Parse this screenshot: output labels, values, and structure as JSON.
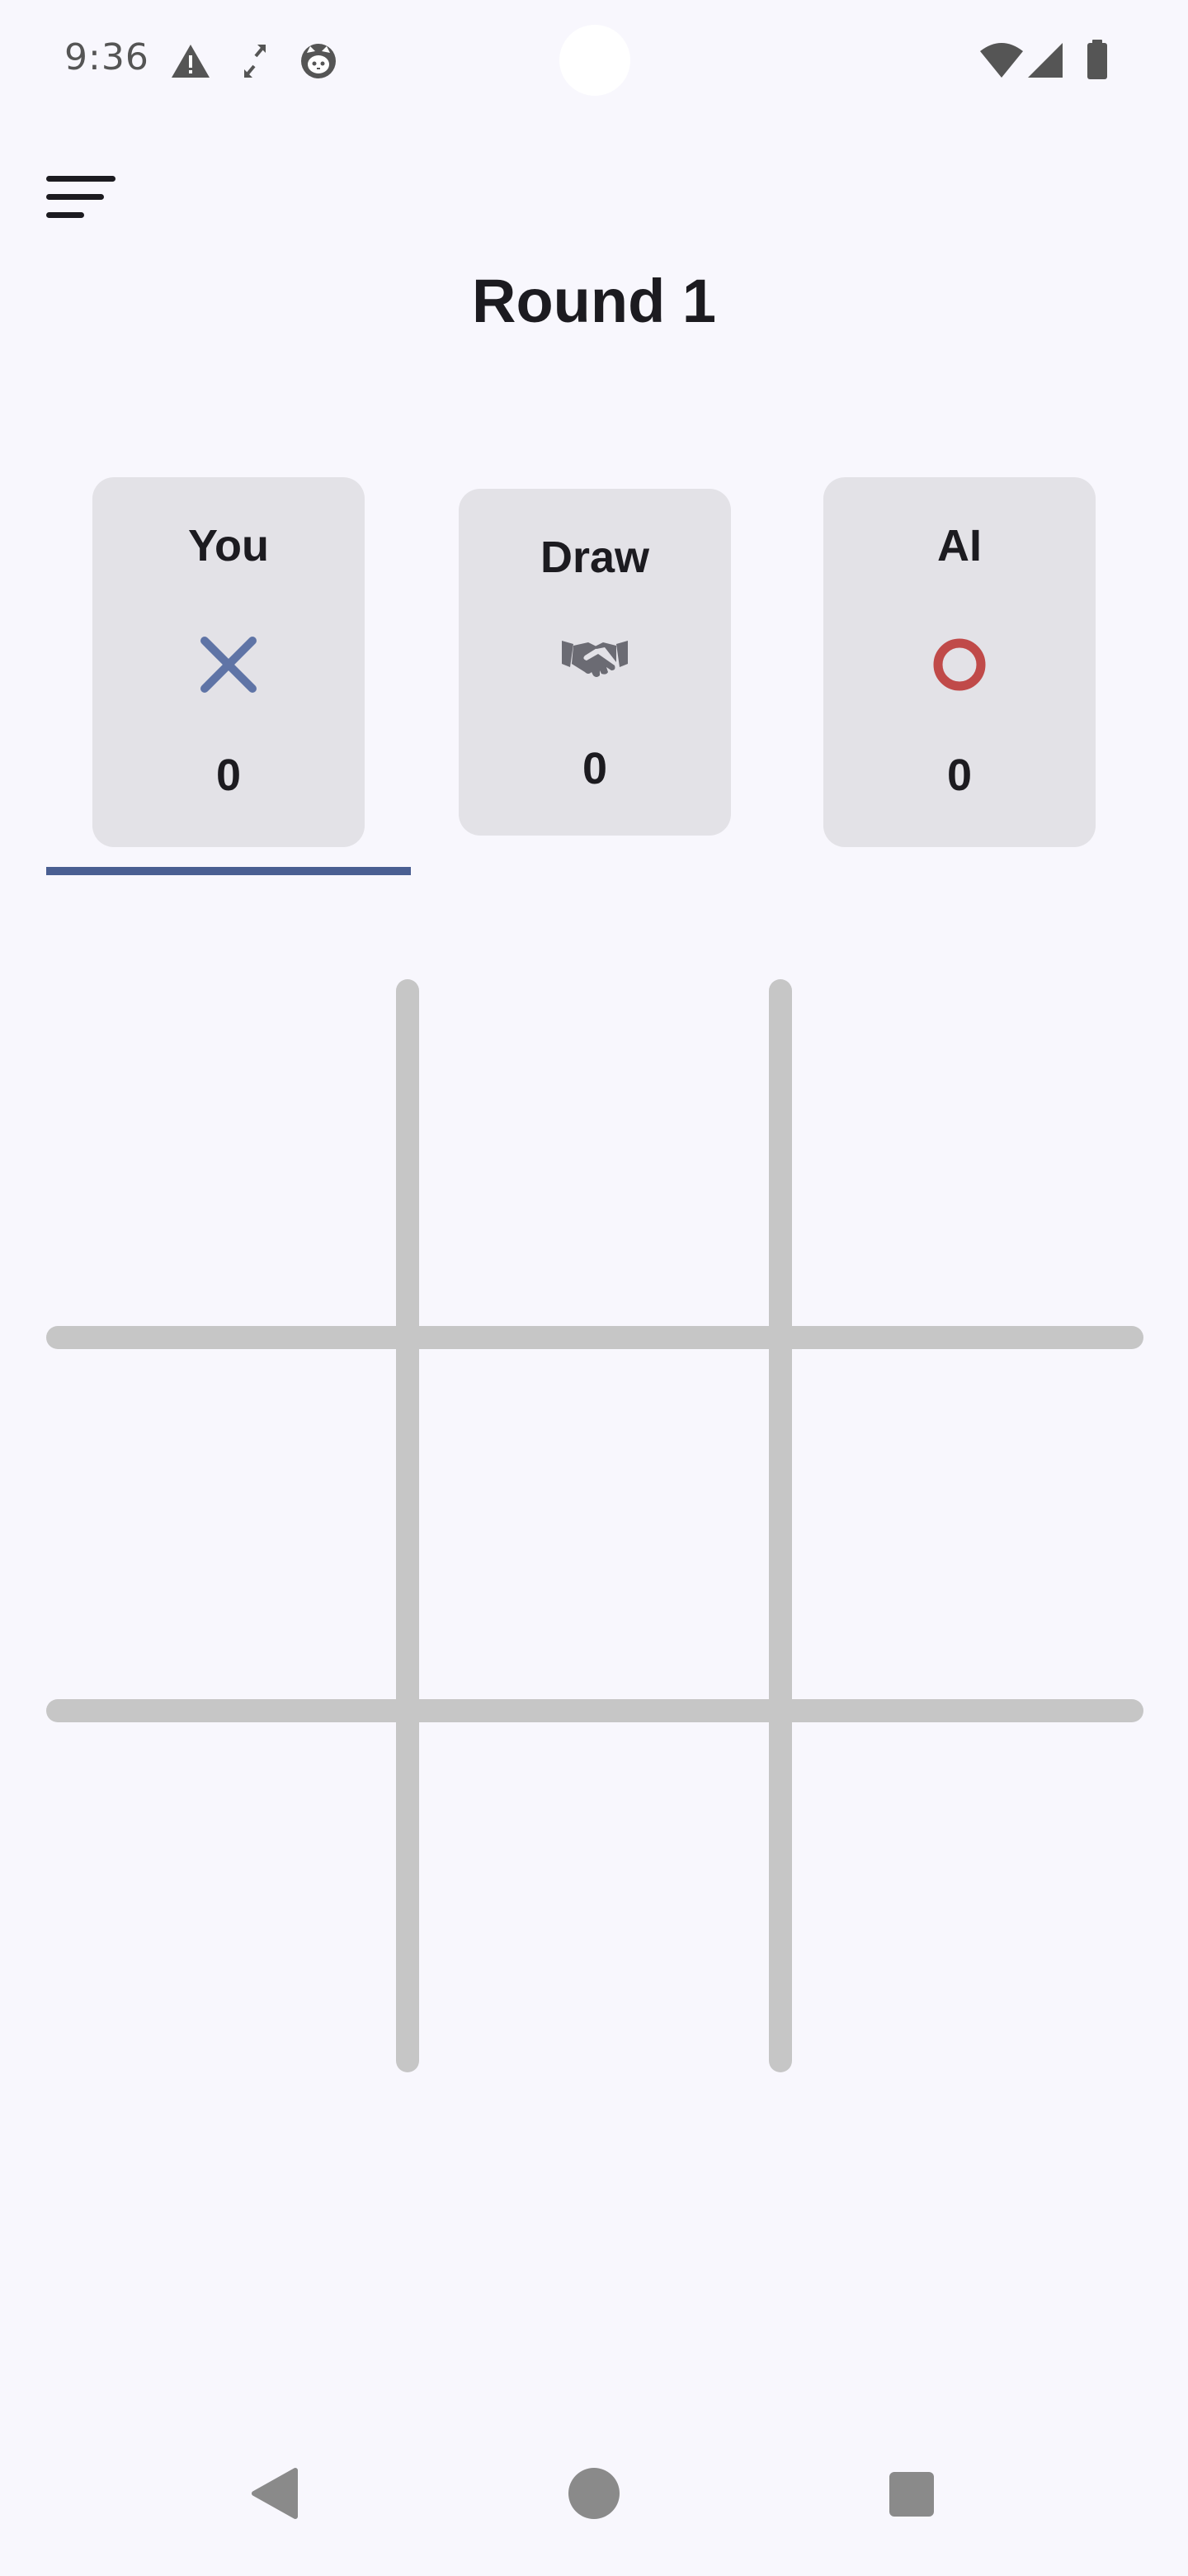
{
  "status_bar": {
    "time": "9:36",
    "left_icons": [
      "warning-icon",
      "expand-arrows-icon",
      "cat-face-icon"
    ],
    "right_icons": [
      "wifi-icon",
      "signal-icon",
      "battery-icon"
    ]
  },
  "header": {
    "menu_icon": "menu-icon",
    "title": "Round 1"
  },
  "scoreboard": {
    "you": {
      "label": "You",
      "icon": "x-mark-icon",
      "count": "0",
      "color": "#5f74a6"
    },
    "draw": {
      "label": "Draw",
      "icon": "handshake-icon",
      "count": "0",
      "color": "#6b6b73"
    },
    "ai": {
      "label": "AI",
      "icon": "circle-mark-icon",
      "count": "0",
      "color": "#c04a49"
    },
    "active_player": "you",
    "accent_color": "#4a5f92"
  },
  "board": {
    "rows": 3,
    "cols": 3,
    "cells": [
      "",
      "",
      "",
      "",
      "",
      "",
      "",
      "",
      ""
    ],
    "line_color": "#c6c6c6"
  },
  "nav_bar": {
    "buttons": [
      "back-icon",
      "home-icon",
      "recents-icon"
    ]
  }
}
